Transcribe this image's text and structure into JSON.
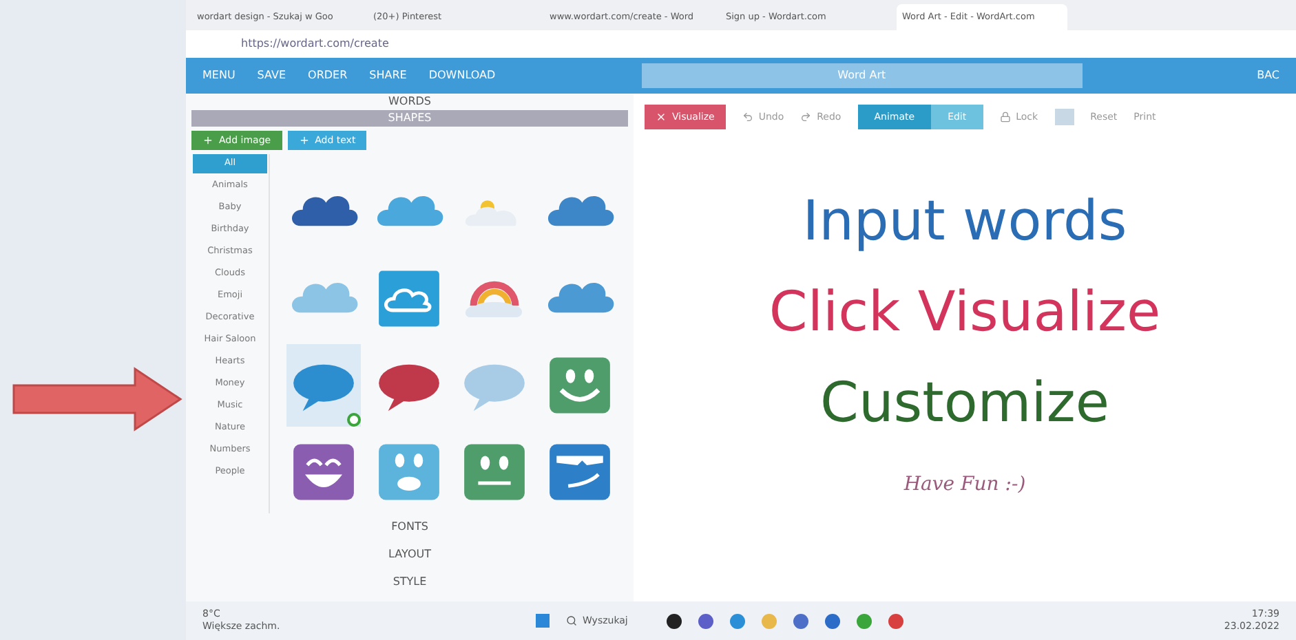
{
  "browser": {
    "tabs": [
      {
        "title": "wordart design - Szukaj w Goo",
        "selected": false
      },
      {
        "title": "(20+) Pinterest",
        "selected": false
      },
      {
        "title": "www.wordart.com/create - Word",
        "selected": false
      },
      {
        "title": "Sign up - Wordart.com",
        "selected": false
      },
      {
        "title": "Word Art - Edit - WordArt.com",
        "selected": true
      }
    ],
    "address": "https://wordart.com/create"
  },
  "app_toolbar": {
    "items": [
      "MENU",
      "SAVE",
      "ORDER",
      "SHARE",
      "DOWNLOAD"
    ],
    "title": "Word Art",
    "back": "BAC"
  },
  "left_panel": {
    "words_header": "WORDS",
    "shapes_header": "SHAPES",
    "add_image": "Add image",
    "add_text": "Add text",
    "categories": [
      {
        "label": "All",
        "selected": true
      },
      {
        "label": "Animals",
        "selected": false
      },
      {
        "label": "Baby",
        "selected": false
      },
      {
        "label": "Birthday",
        "selected": false
      },
      {
        "label": "Christmas",
        "selected": false
      },
      {
        "label": "Clouds",
        "selected": false
      },
      {
        "label": "Emoji",
        "selected": false
      },
      {
        "label": "Decorative",
        "selected": false
      },
      {
        "label": "Hair Saloon",
        "selected": false
      },
      {
        "label": "Hearts",
        "selected": false
      },
      {
        "label": "Money",
        "selected": false
      },
      {
        "label": "Music",
        "selected": false
      },
      {
        "label": "Nature",
        "selected": false
      },
      {
        "label": "Numbers",
        "selected": false
      },
      {
        "label": "People",
        "selected": false
      }
    ],
    "shapes": [
      {
        "kind": "cloud",
        "color": "#2f5fa8",
        "selected": false
      },
      {
        "kind": "cloud",
        "color": "#4aa8dc",
        "selected": false
      },
      {
        "kind": "sun-cloud",
        "color": "#e8eef4",
        "selected": false
      },
      {
        "kind": "cloud",
        "color": "#3d86c8",
        "selected": false
      },
      {
        "kind": "cloud",
        "color": "#8cc4e6",
        "selected": false
      },
      {
        "kind": "cloud-tile",
        "color": "#2b9fd8",
        "selected": false
      },
      {
        "kind": "rainbow-cloud",
        "color": "#e0566a",
        "selected": false
      },
      {
        "kind": "cloud",
        "color": "#4b9ad4",
        "selected": false
      },
      {
        "kind": "bubble",
        "color": "#2d8ecf",
        "selected": true
      },
      {
        "kind": "bubble",
        "color": "#c0394a",
        "selected": false
      },
      {
        "kind": "bubble",
        "color": "#a8cbe6",
        "selected": false
      },
      {
        "kind": "face-smile",
        "color": "#4f9d6a",
        "selected": false
      },
      {
        "kind": "face-grin",
        "color": "#8a5db0",
        "selected": false
      },
      {
        "kind": "face-surprised",
        "color": "#5cb3dc",
        "selected": false
      },
      {
        "kind": "face-neutral",
        "color": "#4f9d6a",
        "selected": false
      },
      {
        "kind": "face-cool",
        "color": "#2d7fc8",
        "selected": false
      }
    ],
    "sections": [
      "FONTS",
      "LAYOUT",
      "STYLE"
    ]
  },
  "editor_toolbar": {
    "visualize": "Visualize",
    "undo": "Undo",
    "redo": "Redo",
    "modes": [
      {
        "label": "Animate",
        "selected": true
      },
      {
        "label": "Edit",
        "selected": false
      }
    ],
    "lock": "Lock",
    "reset": "Reset",
    "print": "Print"
  },
  "canvas": {
    "lines": [
      {
        "text": "Input words",
        "color": "#2a6db4"
      },
      {
        "text": "Click Visualize",
        "color": "#d3345c"
      },
      {
        "text": "Customize",
        "color": "#2e6a2e"
      }
    ],
    "footer": "Have Fun :-)"
  },
  "taskbar": {
    "weather": "8°C",
    "weather_note": "Większe zachm.",
    "search": "Wyszukaj",
    "time": "17:39",
    "date": "23.02.2022"
  }
}
